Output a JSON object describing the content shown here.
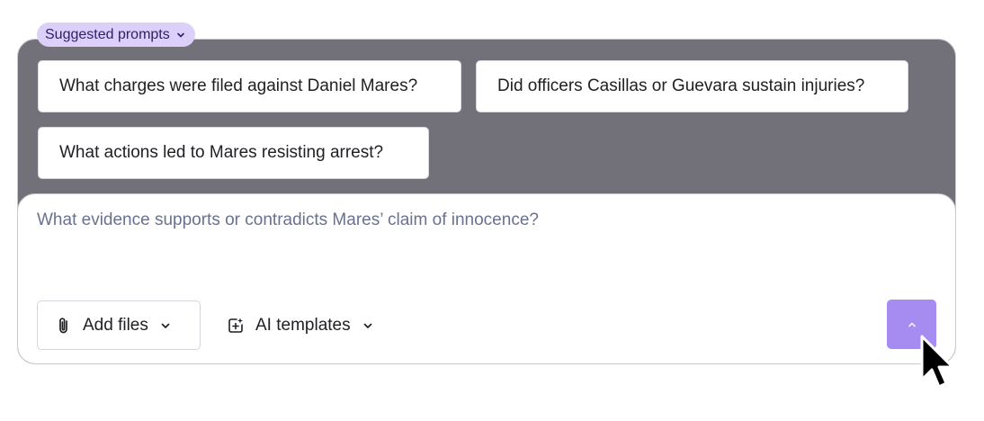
{
  "suggested": {
    "label": "Suggested prompts",
    "toggle_icon": "chevron-down-icon",
    "prompts": [
      "What charges were filed against Daniel Mares?",
      "Did officers Casillas or Guevara sustain injuries?",
      "What actions led to Mares resisting arrest?"
    ]
  },
  "composer": {
    "placeholder": "What evidence supports or contradicts Mares’ claim of innocence?",
    "value": ""
  },
  "toolbar": {
    "add_files_label": "Add files",
    "add_files_icon": "paperclip-icon",
    "ai_templates_label": "AI templates",
    "ai_templates_icon": "template-sparkle-icon",
    "send_icon": "chevron-up-icon"
  },
  "colors": {
    "accent": "#a68bf0",
    "pill_bg": "#dcd0fa",
    "panel_bg": "#727079",
    "placeholder": "#687290"
  }
}
